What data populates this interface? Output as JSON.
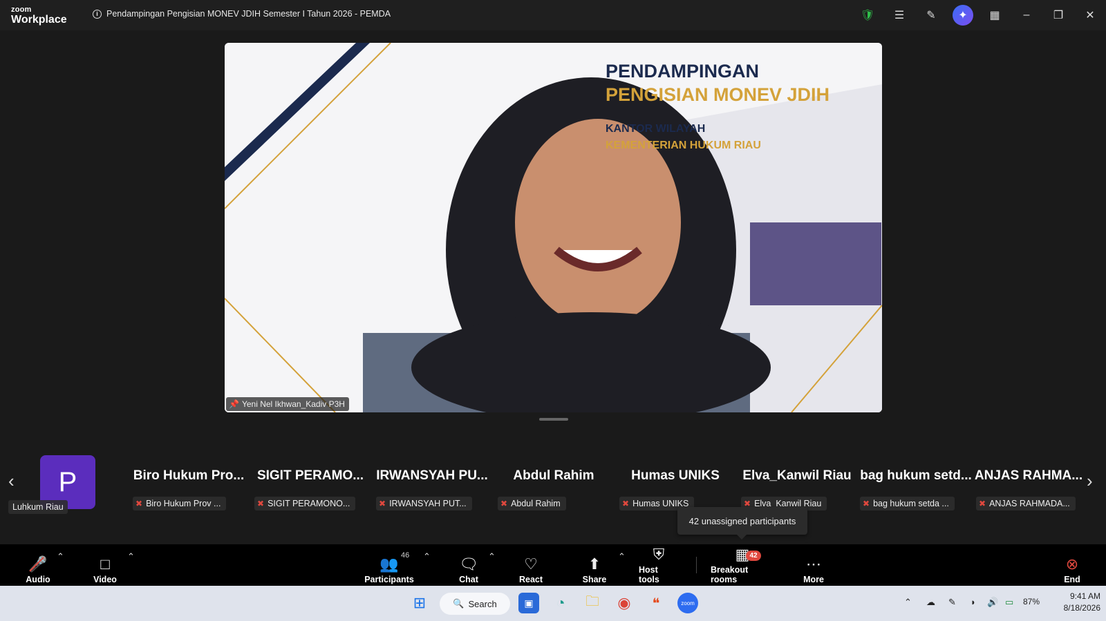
{
  "app": {
    "logo_top": "zoom",
    "logo_bottom": "Workplace",
    "meeting_title": "Pendampingan Pengisian MONEV JDIH Semester I Tahun 2026 - PEMDA"
  },
  "titlebar_icons": [
    "shield-check-icon",
    "notes-icon",
    "whiteboard-pen-icon",
    "ai-companion-icon",
    "apps-grid-icon",
    "minimize-icon",
    "restore-icon",
    "close-icon"
  ],
  "video": {
    "slide_line1": "PENDAMPINGAN",
    "slide_line2": "PENGISIAN MONEV JDIH",
    "slide_line3": "KANTOR WILAYAH",
    "slide_line4": "KEMENTERIAN HUKUM RIAU",
    "speaker_name": "Yeni Nel Ikhwan_Kadiv P3H"
  },
  "gallery": {
    "first": {
      "initial": "P",
      "label": "Luhkum Riau"
    },
    "tiles": [
      {
        "name": "Biro Hukum Pro...",
        "label": "Biro Hukum Prov ..."
      },
      {
        "name": "SIGIT  PERAMO...",
        "label": "SIGIT PERAMONO..."
      },
      {
        "name": "IRWANSYAH  PU...",
        "label": "IRWANSYAH PUT..."
      },
      {
        "name": "Abdul Rahim",
        "label": "Abdul Rahim"
      },
      {
        "name": "Humas UNIKS",
        "label": "Humas UNIKS"
      },
      {
        "name": "Elva_Kanwil Riau",
        "label": "Elva_Kanwil Riau"
      },
      {
        "name": "bag  hukum  setd...",
        "label": "bag hukum setda ..."
      },
      {
        "name": "ANJAS  RAHMA...",
        "label": "ANJAS RAHMADA..."
      }
    ]
  },
  "tooltip": "42 unassigned participants",
  "toolbar": {
    "audio": "Audio",
    "video": "Video",
    "participants": "Participants",
    "participants_count": "46",
    "chat": "Chat",
    "react": "React",
    "share": "Share",
    "host_tools": "Host tools",
    "breakout": "Breakout rooms",
    "breakout_badge": "42",
    "more": "More",
    "end": "End"
  },
  "taskbar": {
    "search": "Search",
    "battery": "87%",
    "time": "9:41 AM",
    "date": "8/18/2026"
  }
}
